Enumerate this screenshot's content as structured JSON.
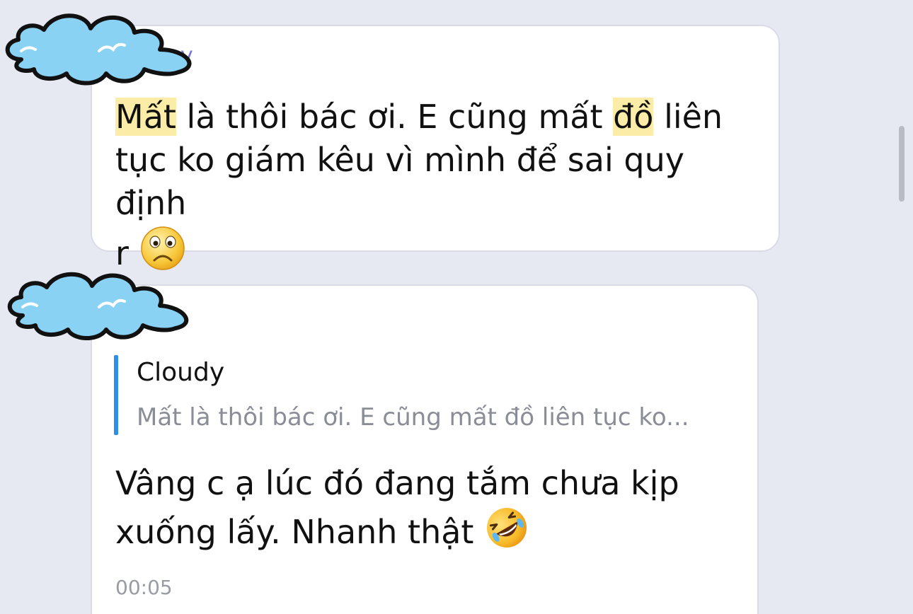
{
  "messages": [
    {
      "sender_peek": "y",
      "text_parts": [
        "Mất",
        " là thôi bác ơi. E cũng mất ",
        "đồ",
        " liên\ntục ko giám kêu vì mình để sai quy định\nr "
      ],
      "emoji": "frowning-face"
    },
    {
      "reply_to": {
        "name": "Cloudy",
        "text": "Mất là thôi bác ơi. E cũng mất đồ liên tục ko..."
      },
      "text": "Vâng c ạ lúc đó đang tắm chưa kịp\nxuống lấy. Nhanh thật ",
      "emoji": "rolling-on-floor-laughing-face",
      "time": "00:05"
    }
  ],
  "avatar_icon": "cloud-sticker",
  "colors": {
    "background": "#e6e9f2",
    "bubble": "#ffffff",
    "highlight": "#fbeda7",
    "quote_bar": "#2d8fe8",
    "sender_name": "#7777d8",
    "cloud_fill": "#8ad2f4"
  }
}
